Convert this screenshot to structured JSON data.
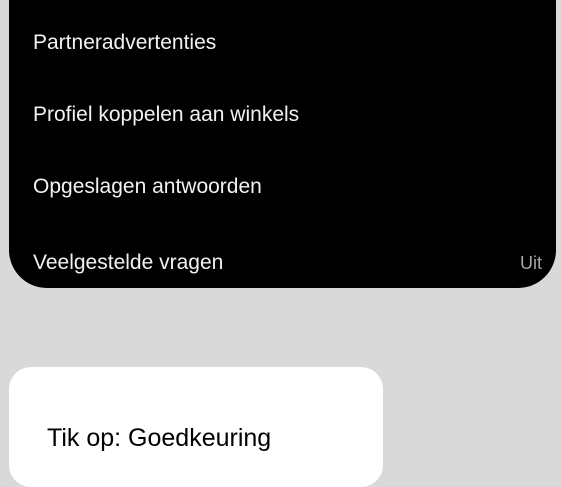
{
  "menu": {
    "items": [
      {
        "label": "Partneradvertenties",
        "value": ""
      },
      {
        "label": "Profiel koppelen aan winkels",
        "value": ""
      },
      {
        "label": "Opgeslagen antwoorden",
        "value": ""
      },
      {
        "label": "Veelgestelde vragen",
        "value": "Uit"
      }
    ]
  },
  "instruction": {
    "text": "Tik op: Goedkeuring"
  },
  "colors": {
    "background": "#d9d9d9",
    "panel": "#000000",
    "text": "#f2f2f2",
    "value_text": "#a6a6a6",
    "card": "#ffffff"
  }
}
